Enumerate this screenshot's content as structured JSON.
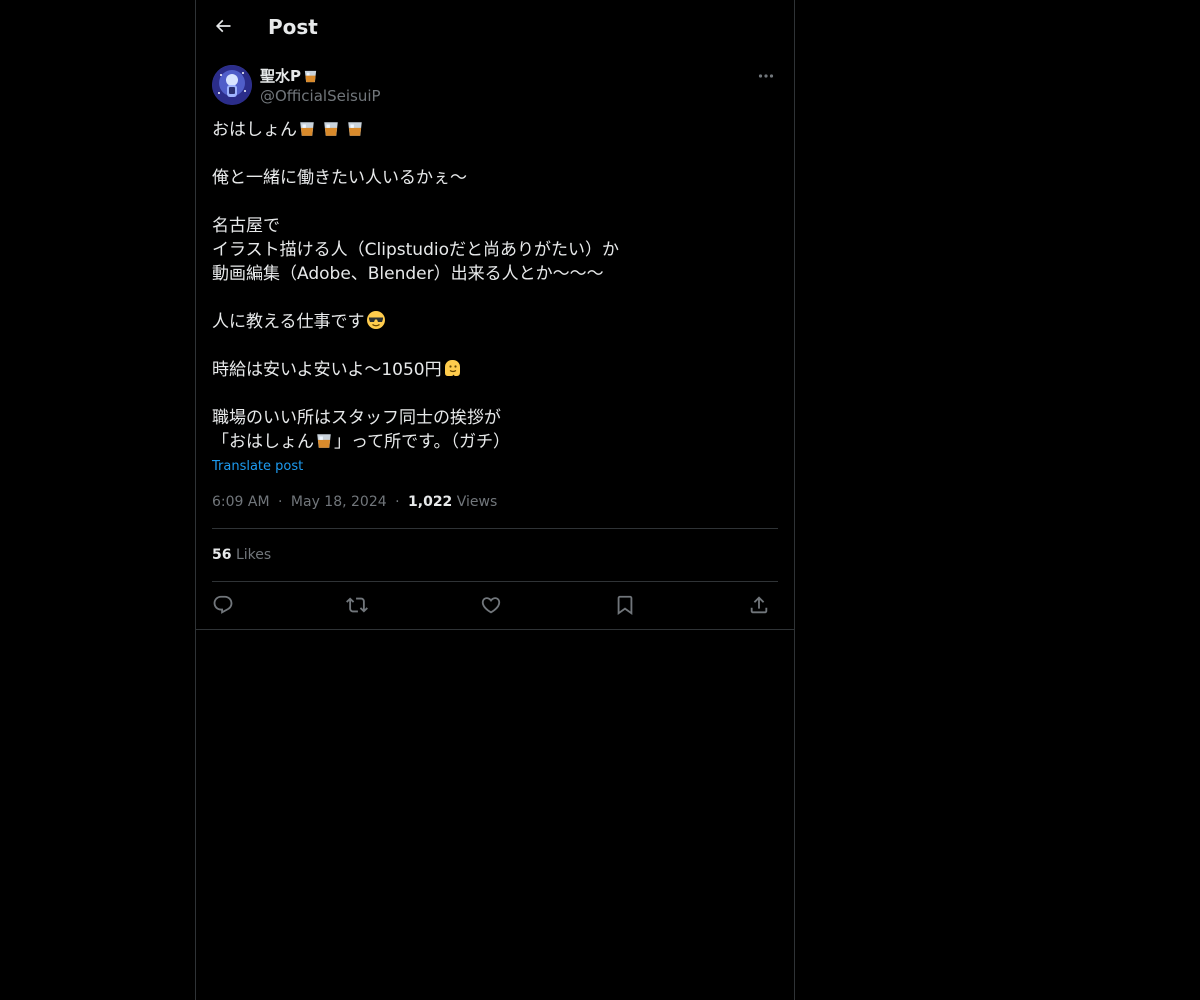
{
  "header": {
    "title": "Post"
  },
  "author": {
    "display_name": "聖水P",
    "handle": "@OfficialSeisuiP"
  },
  "post": {
    "lines": [
      "おはしょん",
      "",
      "俺と一緒に働きたい人いるかぇ〜",
      "",
      "名古屋で",
      "イラスト描ける人（Clipstudioだと尚ありがたい）か",
      "動画編集（Adobe、Blender）出来る人とか〜〜〜",
      "",
      "人に教える仕事です",
      "",
      "時給は安いよ安いよ〜1050円",
      "",
      "職場のいい所はスタッフ同士の挨拶が",
      "「おはしょん",
      "」って所です。（ガチ）"
    ],
    "translate_label": "Translate post"
  },
  "meta": {
    "time": "6:09 AM",
    "separator": "·",
    "date": "May 18, 2024",
    "views_count": "1,022",
    "views_label": "Views"
  },
  "stats": {
    "likes_count": "56",
    "likes_label": "Likes"
  },
  "icons": {
    "back": "arrow-left-icon",
    "more": "more-horizontal-icon",
    "reply": "reply-icon",
    "repost": "repost-icon",
    "like": "heart-icon",
    "bookmark": "bookmark-icon",
    "share": "share-icon",
    "emoji_whisky": "tumbler-glass-icon",
    "emoji_sunglasses": "sunglasses-face-icon",
    "emoji_melting": "melting-face-icon"
  },
  "colors": {
    "background": "#000000",
    "text": "#e7e9ea",
    "secondary": "#71767b",
    "link": "#1d9bf0",
    "border": "#2f3336"
  }
}
